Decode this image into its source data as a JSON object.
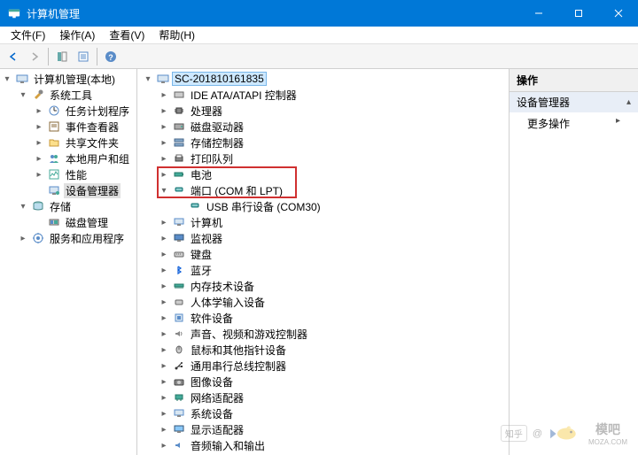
{
  "window": {
    "title": "计算机管理"
  },
  "menu": {
    "file": "文件(F)",
    "action": "操作(A)",
    "view": "查看(V)",
    "help": "帮助(H)"
  },
  "left_tree": {
    "root": "计算机管理(本地)",
    "system_tools": "系统工具",
    "task_scheduler": "任务计划程序",
    "event_viewer": "事件查看器",
    "shared_folders": "共享文件夹",
    "local_users": "本地用户和组",
    "performance": "性能",
    "device_manager": "设备管理器",
    "storage": "存储",
    "disk_mgmt": "磁盘管理",
    "services_apps": "服务和应用程序"
  },
  "center_tree": {
    "computer": "SC-201810161835",
    "ide": "IDE ATA/ATAPI 控制器",
    "cpu": "处理器",
    "disk_drives": "磁盘驱动器",
    "storage_ctrl": "存储控制器",
    "print_queue": "打印队列",
    "battery": "电池",
    "ports": "端口 (COM 和 LPT)",
    "usb_serial": "USB 串行设备 (COM30)",
    "computers": "计算机",
    "monitors": "监视器",
    "keyboards": "键盘",
    "bluetooth": "蓝牙",
    "memory_dev": "内存技术设备",
    "hid": "人体学输入设备",
    "software_dev": "软件设备",
    "sound": "声音、视频和游戏控制器",
    "mice": "鼠标和其他指针设备",
    "usb_ctrl": "通用串行总线控制器",
    "imaging": "图像设备",
    "network": "网络适配器",
    "system_dev": "系统设备",
    "display": "显示适配器",
    "audio_io": "音频输入和输出"
  },
  "right": {
    "header": "操作",
    "sub": "设备管理器",
    "more": "更多操作"
  },
  "watermark": {
    "zhihu": "知乎",
    "moba": "模吧",
    "domain": "MOZA.COM"
  }
}
